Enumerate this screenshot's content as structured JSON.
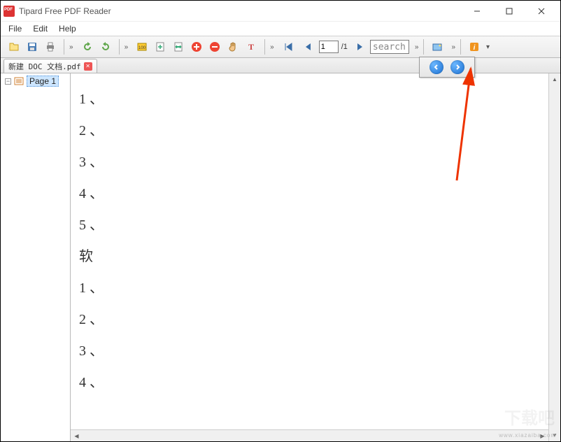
{
  "title": "Tipard Free PDF Reader",
  "menu": {
    "file": "File",
    "edit": "Edit",
    "help": "Help"
  },
  "toolbar": {
    "page_current": "1",
    "page_total": "/1",
    "search_placeholder": "search"
  },
  "tab": {
    "filename": "新建 DOC 文档.pdf"
  },
  "sidebar": {
    "page_label": "Page 1"
  },
  "document": {
    "lines": [
      "1 、",
      "2 、",
      "3 、",
      "4 、",
      "5 、",
      "软",
      "1 、",
      "2 、",
      "3 、",
      "4 、"
    ]
  },
  "watermark": {
    "text": "下载吧",
    "url": "www.xiazaiba.com"
  }
}
